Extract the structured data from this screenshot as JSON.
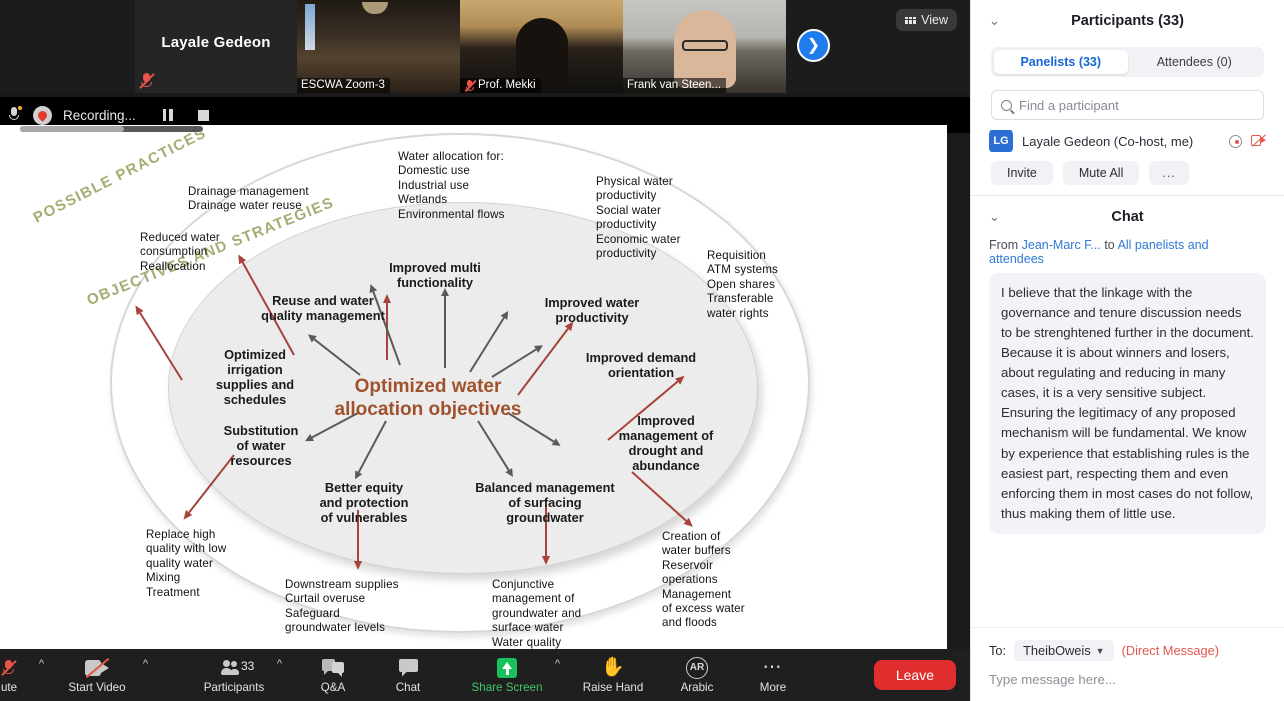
{
  "filmstrip": {
    "self_name": "Layale Gedeon",
    "view_button": "View",
    "view_icon": "grid-icon",
    "next_icon": "chevron-right-icon",
    "tiles": [
      {
        "name": "ESCWA Zoom-3",
        "muted": false,
        "active": false
      },
      {
        "name": "Prof. Mekki",
        "muted": true,
        "active": false
      },
      {
        "name": "Frank van Steen...",
        "muted": false,
        "active": true
      }
    ]
  },
  "recording": {
    "label": "Recording...",
    "mic_icon": "microphone-icon",
    "record_icon": "record-dot-icon",
    "pause_icon": "pause-icon",
    "stop_icon": "stop-icon"
  },
  "slide": {
    "band_possible": "POSSIBLE PRACTICES",
    "band_objectives": "OBJECTIVES AND STRATEGIES",
    "center": "Optimized water\nallocation objectives",
    "center_color": "#a0522d",
    "band_color": "#a8ab72",
    "nodes": [
      {
        "id": "multi-functionality",
        "text": "Improved multi\nfunctionality"
      },
      {
        "id": "reuse-water-quality",
        "text": "Reuse and water\nquality management"
      },
      {
        "id": "water-productivity",
        "text": "Improved water\nproductivity"
      },
      {
        "id": "irrigation-supplies",
        "text": "Optimized\nirrigation\nsupplies and\nschedules"
      },
      {
        "id": "demand-orientation",
        "text": "Improved demand\norientation"
      },
      {
        "id": "substitution-water",
        "text": "Substitution\nof water\nresources"
      },
      {
        "id": "drought-abundance",
        "text": "Improved\nmanagement of\ndrought and\nabundance"
      },
      {
        "id": "better-equity",
        "text": "Better equity\nand protection\nof vulnerables"
      },
      {
        "id": "surfacing-groundwater",
        "text": "Balanced management\nof surfacing\ngroundwater"
      }
    ],
    "practices": [
      {
        "id": "drainage",
        "text": "Drainage management\nDrainage water reuse"
      },
      {
        "id": "water-allocation",
        "text": "Water allocation for:\nDomestic use\nIndustrial use\nWetlands\nEnvironmental flows"
      },
      {
        "id": "productivity-list",
        "text": "Physical water\nproductivity\nSocial water\nproductivity\nEconomic water\nproductivity"
      },
      {
        "id": "reduced-consumption",
        "text": "Reduced water\nconsumption\nReallocation"
      },
      {
        "id": "requisition",
        "text": "Requisition\nATM systems\nOpen shares\nTransferable\nwater rights"
      },
      {
        "id": "replace-quality",
        "text": "Replace high\nquality with low\nquality water\nMixing\nTreatment"
      },
      {
        "id": "downstream",
        "text": "Downstream supplies\nCurtail overuse\nSafeguard\ngroundwater levels"
      },
      {
        "id": "conjunctive",
        "text": "Conjunctive\nmanagement of\ngroundwater and\nsurface water\nWater quality\nmanagement"
      },
      {
        "id": "water-buffers",
        "text": "Creation of\nwater buffers\nReservoir\noperations\nManagement\nof excess water\nand floods"
      }
    ]
  },
  "toolbar": {
    "mute": "ute",
    "start_video": "Start Video",
    "participants": "Participants",
    "participants_count": "33",
    "qa": "Q&A",
    "chat": "Chat",
    "share_screen": "Share Screen",
    "raise_hand": "Raise Hand",
    "arabic": "Arabic",
    "arabic_badge": "AR",
    "more": "More",
    "leave": "Leave",
    "share_color": "#18c25a",
    "leave_color": "#e02d2d"
  },
  "participants_panel": {
    "title": "Participants (33)",
    "tabs": [
      {
        "label": "Panelists (33)",
        "active": true
      },
      {
        "label": "Attendees (0)",
        "active": false
      }
    ],
    "search_placeholder": "Find a participant",
    "search_value": "",
    "first_participant": {
      "initials": "LG",
      "name": "Layale Gedeon (Co-host, me)"
    },
    "actions": {
      "invite": "Invite",
      "mute_all": "Mute All",
      "more": "..."
    }
  },
  "chat_panel": {
    "title": "Chat",
    "from_prefix": "From",
    "from_name": "Jean-Marc F...",
    "to_word": "to",
    "to_target": "All panelists and attendees",
    "message": "I believe that the linkage with the governance and tenure discussion needs to be strenghtened further in the document. Because it is about winners and losers, about regulating and reducing in many cases, it is a very sensitive subject. Ensuring the legitimacy of any proposed mechanism will be fundamental. We know by experience that establishing rules is the easiest part, respecting them and even enforcing them in most cases do not follow, thus making them of little use.",
    "to_label": "To:",
    "to_selected": "TheibOweis",
    "direct_message": "(Direct Message)",
    "input_placeholder": "Type message here..."
  }
}
